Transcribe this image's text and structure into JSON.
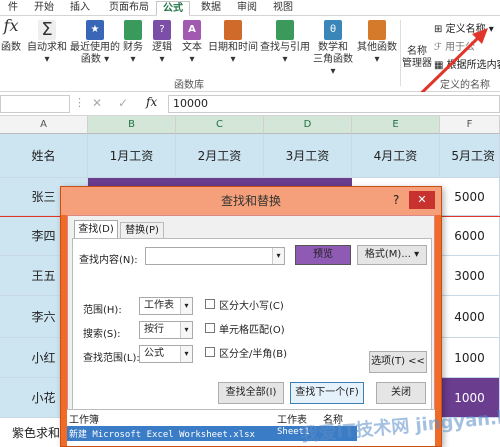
{
  "ribbon_tabs": [
    "件",
    "开始",
    "插入",
    "页面布局",
    "公式",
    "数据",
    "审阅",
    "视图"
  ],
  "ribbon": {
    "fx_label": "fx",
    "fx_sub": "函数",
    "buttons": [
      {
        "label": "自动求和",
        "caret": "▾",
        "icon": "sigma-icon",
        "color": "#e9e9e9"
      },
      {
        "label": "最近使用的",
        "sub": "函数 ▾",
        "icon": "star-icon",
        "color": "#3a66b8"
      },
      {
        "label": "财务",
        "sub": "▾",
        "icon": "finance-icon",
        "color": "#3a9a5b"
      },
      {
        "label": "逻辑",
        "sub": "▾",
        "icon": "logic-icon",
        "color": "#7b4ea8"
      },
      {
        "label": "文本",
        "sub": "▾",
        "icon": "text-icon",
        "color": "#a25ab0"
      },
      {
        "label": "日期和时间",
        "sub": "▾",
        "icon": "calendar-icon",
        "color": "#d06a2a"
      },
      {
        "label": "查找与引用",
        "sub": "▾",
        "icon": "lookup-icon",
        "color": "#3b9a5b"
      },
      {
        "label": "数学和",
        "sub": "三角函数 ▾",
        "icon": "math-icon",
        "color": "#3b86b8"
      },
      {
        "label": "其他函数",
        "sub": "▾",
        "icon": "more-functions-icon",
        "color": "#d57a2a"
      }
    ],
    "group_label": "函数库",
    "name_manager": "名称",
    "name_manager_sub": "管理器",
    "define_name": "定义名称",
    "use_in_formula": "用于公",
    "create_from_selection": "根据所选内容创",
    "defined_names_group": "定义的名称"
  },
  "formula_bar": {
    "cancel": "✕",
    "confirm": "✓",
    "fx": "fx",
    "value": "10000"
  },
  "grid": {
    "columns": [
      "A",
      "B",
      "C",
      "D",
      "E",
      "F"
    ],
    "header_row": [
      "姓名",
      "1月工资",
      "2月工资",
      "3月工资",
      "4月工资",
      "5月工资"
    ],
    "names": [
      "张三",
      "李四",
      "王五",
      "李六",
      "小红",
      "小花",
      "紫色求和"
    ],
    "last_col": [
      "5000",
      "6000",
      "3000",
      "4000",
      "1000",
      "1000"
    ]
  },
  "dialog": {
    "title": "查找和替换",
    "help": "?",
    "close": "✕",
    "tab_find": "查找(D)",
    "tab_replace": "替换(P)",
    "find_what_label": "查找内容(N):",
    "preview_label": "预览",
    "format_label": "格式(M)...",
    "within_label": "范围(H):",
    "within_value": "工作表",
    "search_label": "搜索(S):",
    "search_value": "按行",
    "lookin_label": "查找范围(L):",
    "lookin_value": "公式",
    "match_case": "区分大小写(C)",
    "match_entire": "单元格匹配(O)",
    "match_byte": "区分全/半角(B)",
    "options": "选项(T) <<",
    "find_all": "查找全部(I)",
    "find_next": "查找下一个(F)",
    "close_btn": "关闭",
    "results_headers": [
      "工作簿",
      "工作表",
      "名称"
    ],
    "results_row": [
      "新建 Microsoft Excel Worksheet.xlsx",
      "Sheet1"
    ]
  },
  "watermark": "我爱IT技术网 jingyan.baidu.com"
}
